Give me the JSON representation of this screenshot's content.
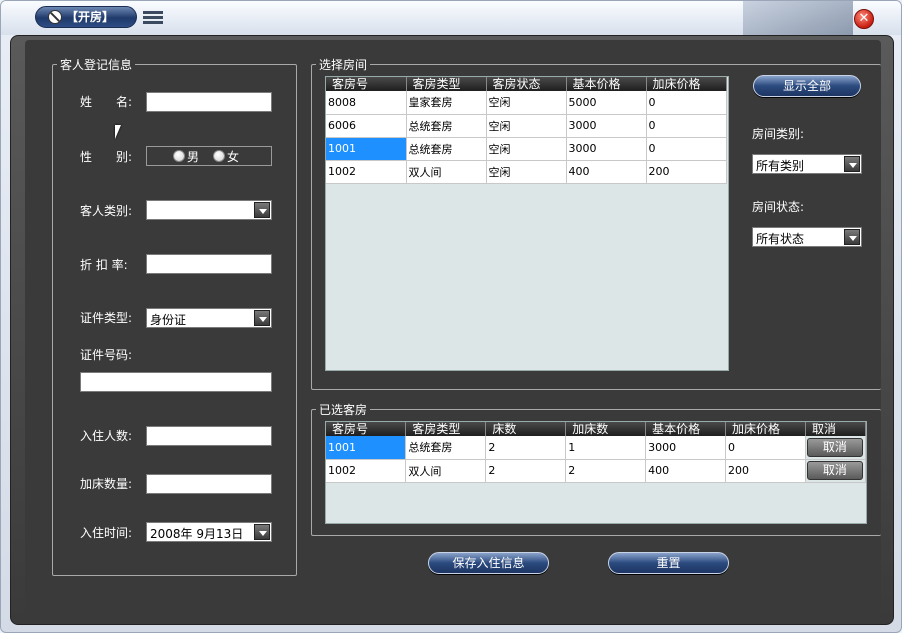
{
  "window": {
    "title": "【开房】",
    "close_glyph": "✕"
  },
  "guest_panel": {
    "legend": "客人登记信息",
    "name_label": "姓　　名:",
    "name_value": "",
    "gender_label": "性　　别:",
    "gender_male": "男",
    "gender_female": "女",
    "guest_type_label": "客人类别:",
    "guest_type_value": "",
    "discount_label": "折 扣 率:",
    "discount_value": "",
    "id_type_label": "证件类型:",
    "id_type_value": "身份证",
    "id_number_label": "证件号码:",
    "id_number_value": "",
    "occupants_label": "入住人数:",
    "occupants_value": "",
    "extra_beds_label": "加床数量:",
    "extra_beds_value": "",
    "checkin_label": "入住时间:",
    "checkin_value": "2008年 9月13日"
  },
  "room_select": {
    "legend": "选择房间",
    "columns": [
      "客房号",
      "客房类型",
      "客房状态",
      "基本价格",
      "加床价格"
    ],
    "rows": [
      [
        "8008",
        "皇家套房",
        "空闲",
        "5000",
        "0"
      ],
      [
        "6006",
        "总统套房",
        "空闲",
        "3000",
        "0"
      ],
      [
        "1001",
        "总统套房",
        "空闲",
        "3000",
        "0"
      ],
      [
        "1002",
        "双人间",
        "空闲",
        "400",
        "200"
      ]
    ],
    "show_all_button": "显示全部",
    "room_type_label": "房间类别:",
    "room_type_value": "所有类别",
    "room_status_label": "房间状态:",
    "room_status_value": "所有状态"
  },
  "selected_rooms": {
    "legend": "已选客房",
    "columns": [
      "客房号",
      "客房类型",
      "床数",
      "加床数",
      "基本价格",
      "加床价格",
      "取消"
    ],
    "rows": [
      [
        "1001",
        "总统套房",
        "2",
        "1",
        "3000",
        "0",
        "取消"
      ],
      [
        "1002",
        "双人间",
        "2",
        "2",
        "400",
        "200",
        "取消"
      ]
    ]
  },
  "actions": {
    "save_button": "保存入住信息",
    "reset_button": "重置"
  }
}
